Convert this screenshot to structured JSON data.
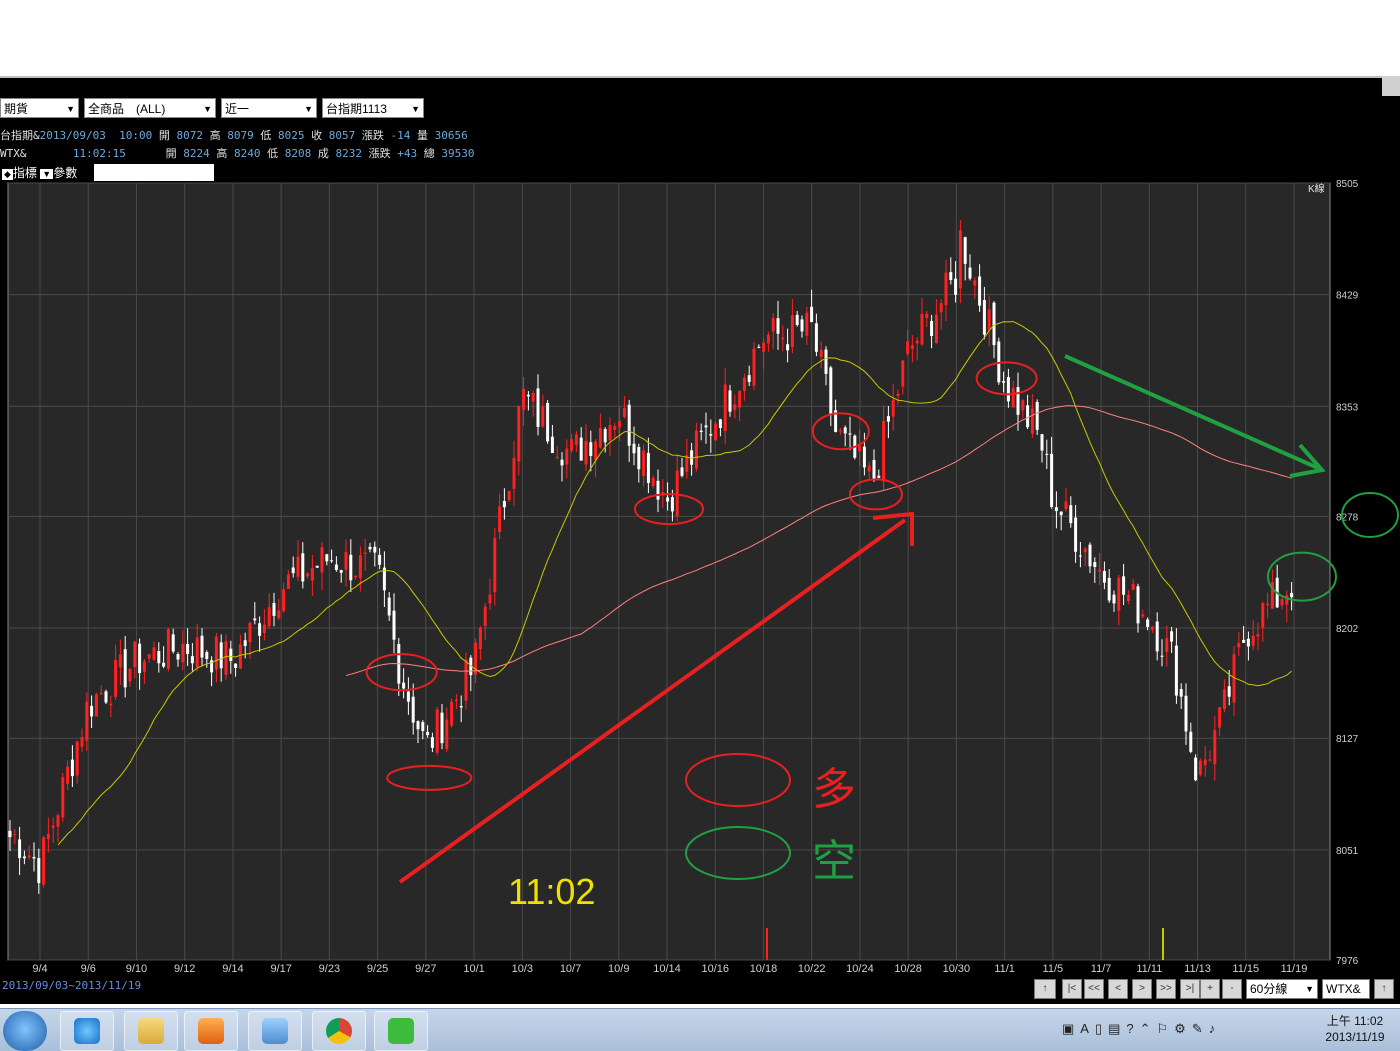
{
  "toolbar": {
    "market": "期貨",
    "product": "全商品　(ALL)",
    "period": "近一",
    "contract": "台指期1113"
  },
  "quotes": [
    {
      "name": "台指期&",
      "datetime": "2013/09/03  10:00",
      "open_label": "開",
      "open": "8072",
      "high_label": "高",
      "high": "8079",
      "low_label": "低",
      "low": "8025",
      "close_label": "收",
      "close": "8057",
      "chg_label": "漲跌",
      "chg": "-14",
      "vol_label": "量",
      "vol": "30656"
    },
    {
      "name": "WTX&",
      "datetime": "    11:02:15",
      "open_label": "開",
      "open": "8224",
      "high_label": "高",
      "high": "8240",
      "low_label": "低",
      "low": "8208",
      "close_label": "成",
      "close": "8232",
      "chg_label": "漲跌",
      "chg": "+43",
      "vol_label": "總",
      "vol": "39530"
    }
  ],
  "tabs": {
    "indicator": "指標",
    "param": "參數"
  },
  "chart_type_label": "K線",
  "annotations": {
    "time": "11:02",
    "legend_bull": "多",
    "legend_bear": "空"
  },
  "date_range": "2013/09/03~2013/11/19",
  "nav": {
    "interval": "60分線",
    "symbol": "WTX&"
  },
  "taskbar": {
    "time": "上午 11:02",
    "date": "2013/11/19"
  },
  "colors": {
    "up": "#ff2020",
    "down": "#ffffff",
    "ma_short": "#c8c800",
    "ma_long": "#ff8080",
    "annot_red": "#e82020",
    "annot_green": "#20a040",
    "annot_yellow": "#f0e000"
  },
  "chart_data": {
    "type": "candlestick",
    "interval": "60分線",
    "x_tick_labels": [
      "9/4",
      "9/6",
      "9/10",
      "9/12",
      "9/14",
      "9/17",
      "9/23",
      "9/25",
      "9/27",
      "10/1",
      "10/3",
      "10/7",
      "10/9",
      "10/14",
      "10/16",
      "10/18",
      "10/22",
      "10/24",
      "10/28",
      "10/30",
      "11/1",
      "11/5",
      "11/7",
      "11/11",
      "11/13",
      "11/15",
      "11/19"
    ],
    "y_tick_labels": [
      "8505",
      "8429",
      "8353",
      "8278",
      "8202",
      "8127",
      "8051",
      "7976"
    ],
    "ylim": [
      7976,
      8505
    ],
    "close_path_keypoints": [
      {
        "x": "9/3",
        "y": 8060
      },
      {
        "x": "9/4",
        "y": 8040
      },
      {
        "x": "9/6",
        "y": 8150
      },
      {
        "x": "9/10",
        "y": 8180
      },
      {
        "x": "9/12",
        "y": 8190
      },
      {
        "x": "9/14",
        "y": 8180
      },
      {
        "x": "9/17",
        "y": 8230
      },
      {
        "x": "9/23",
        "y": 8250
      },
      {
        "x": "9/25",
        "y": 8240
      },
      {
        "x": "9/26",
        "y": 8170
      },
      {
        "x": "9/27",
        "y": 8120
      },
      {
        "x": "10/1",
        "y": 8175
      },
      {
        "x": "10/3",
        "y": 8360
      },
      {
        "x": "10/7",
        "y": 8320
      },
      {
        "x": "10/9",
        "y": 8350
      },
      {
        "x": "10/14",
        "y": 8290
      },
      {
        "x": "10/16",
        "y": 8345
      },
      {
        "x": "10/18",
        "y": 8400
      },
      {
        "x": "10/22",
        "y": 8405
      },
      {
        "x": "10/23",
        "y": 8335
      },
      {
        "x": "10/25",
        "y": 8300
      },
      {
        "x": "10/28",
        "y": 8390
      },
      {
        "x": "10/30",
        "y": 8440
      },
      {
        "x": "10/31",
        "y": 8470
      },
      {
        "x": "11/1",
        "y": 8370
      },
      {
        "x": "11/4",
        "y": 8330
      },
      {
        "x": "11/5",
        "y": 8290
      },
      {
        "x": "11/7",
        "y": 8240
      },
      {
        "x": "11/11",
        "y": 8210
      },
      {
        "x": "11/12",
        "y": 8180
      },
      {
        "x": "11/13",
        "y": 8100
      },
      {
        "x": "11/14",
        "y": 8140
      },
      {
        "x": "11/15",
        "y": 8200
      },
      {
        "x": "11/19",
        "y": 8235
      }
    ]
  }
}
